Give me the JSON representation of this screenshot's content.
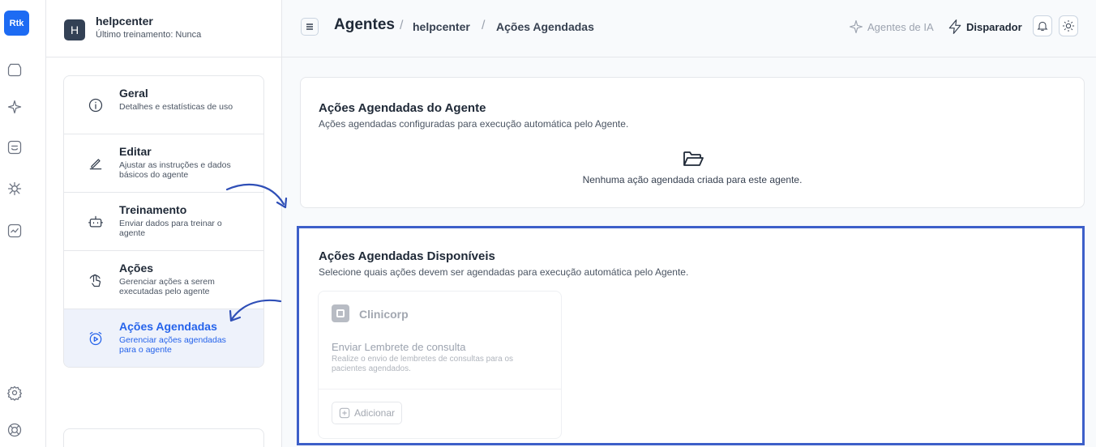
{
  "rail": {
    "logo": "Rtk",
    "items": [
      "home-icon",
      "sparkle-icon",
      "inbox-icon",
      "bug-icon",
      "chart-icon",
      "settings-icon",
      "help-icon"
    ]
  },
  "workspace": {
    "avatar": "H",
    "name": "helpcenter",
    "subtitle": "Último treinamento: Nunca"
  },
  "menu": {
    "items": [
      {
        "title": "Geral",
        "desc": "Detalhes e estatísticas de uso",
        "icon": "info-icon"
      },
      {
        "title": "Editar",
        "desc": "Ajustar as instruções e dados básicos do agente",
        "icon": "pencil-icon"
      },
      {
        "title": "Treinamento",
        "desc": "Enviar dados para treinar o agente",
        "icon": "robot-icon"
      },
      {
        "title": "Ações",
        "desc": "Gerenciar ações a serem executadas pelo agente",
        "icon": "pointer-icon"
      },
      {
        "title": "Ações Agendadas",
        "desc": "Gerenciar ações agendadas para o agente",
        "icon": "alarm-icon",
        "active": true
      }
    ]
  },
  "header": {
    "title": "Agentes",
    "separator": "/",
    "crumb_workspace": "helpcenter",
    "crumb_page": "Ações Agendadas",
    "agents_ia": "Agentes de IA",
    "disparador": "Disparador"
  },
  "scheduled": {
    "title": "Ações Agendadas do Agente",
    "subtitle": "Ações agendadas configuradas para execução automática pelo Agente.",
    "empty": "Nenhuma ação agendada criada para este agente."
  },
  "available": {
    "title": "Ações Agendadas Disponíveis",
    "subtitle": "Selecione quais ações devem ser agendadas para execução automática pelo Agente.",
    "integration": {
      "name": "Clinicorp",
      "action": "Enviar Lembrete de consulta",
      "desc": "Realize o envio de lembretes de consultas para os pacientes agendados.",
      "add_label": "Adicionar"
    }
  },
  "colors": {
    "accent": "#2563eb",
    "logo_bg": "#1d6bf3",
    "highlight_border": "#3d5fc9",
    "active_bg": "#eef2fb"
  }
}
